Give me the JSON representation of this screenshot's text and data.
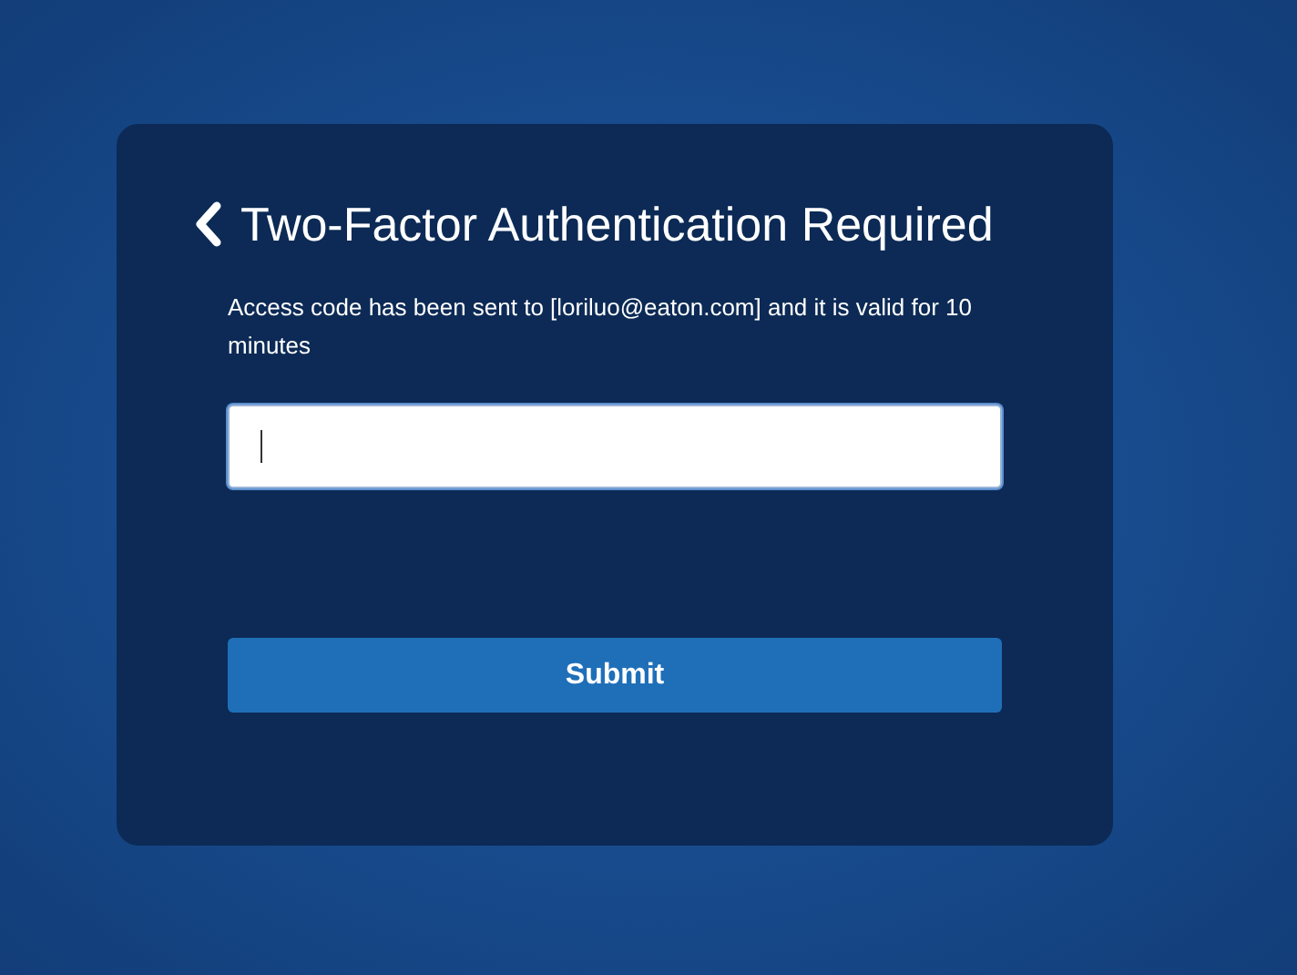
{
  "dialog": {
    "title": "Two-Factor Authentication Required",
    "message": "Access code has been sent to [loriluo@eaton.com] and it is valid for 10 minutes",
    "code_field": {
      "focused": true
    },
    "submit_button": {
      "label": "Submit"
    }
  }
}
